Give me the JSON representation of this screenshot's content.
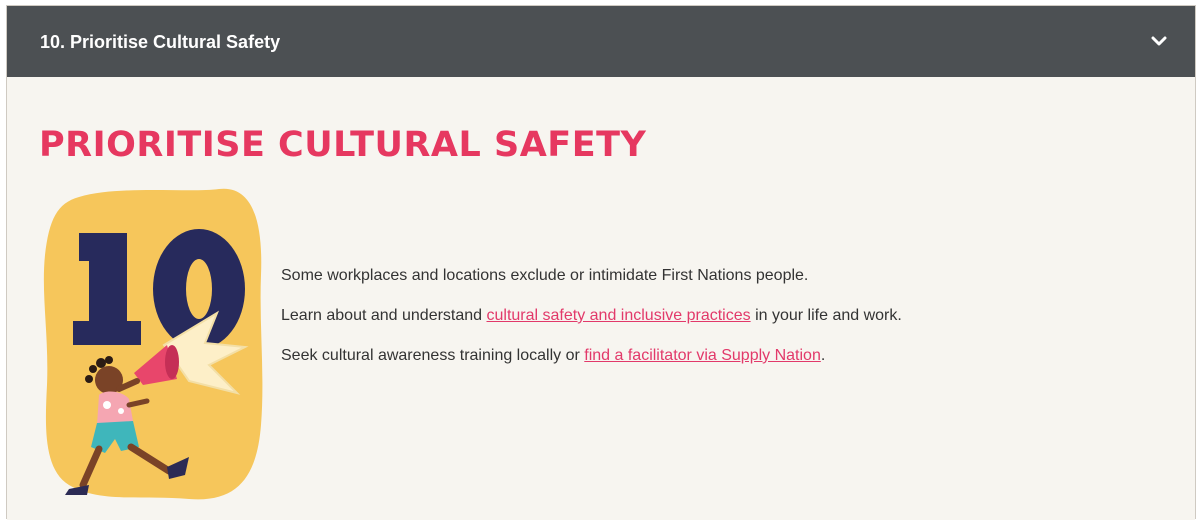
{
  "accordion": {
    "title": "10. Prioritise Cultural Safety",
    "toggle_icon": "chevron-down-icon",
    "header_color": "#4c5053"
  },
  "content": {
    "heading": "PRIORITISE CULTURAL SAFETY",
    "heading_color": "#e63860",
    "illustration": {
      "icon": "megaphone-person-illustration",
      "number": "10",
      "number_color": "#272a5c",
      "blob_color": "#f6c65b"
    },
    "paragraphs": [
      {
        "text": "Some workplaces and locations exclude or intimidate First Nations people."
      },
      {
        "before": "Learn about and understand ",
        "link": "cultural safety and inclusive practices",
        "after": " in your life and work."
      },
      {
        "before": "Seek cultural awareness training locally or ",
        "link": "find a facilitator via Supply Nation",
        "after": "."
      }
    ],
    "link_color": "#e2396a"
  }
}
